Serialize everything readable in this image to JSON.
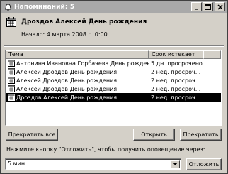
{
  "window": {
    "title": "Напоминаний: 5",
    "minimize_label": "_",
    "maximize_label": "□",
    "close_label": "×"
  },
  "reminder": {
    "subject": "Дроздов Алексей День рождения",
    "start": "Начало: 4 марта 2008 г. 0:00"
  },
  "list": {
    "columns": [
      "Тема",
      "Срок истекает"
    ],
    "rows": [
      {
        "subject": "Антонина Ивановна Горбачева День рождения",
        "due": "5 дн. просрочено"
      },
      {
        "subject": "Алексей Дроздов День рождения",
        "due": "2 нед. просроч..."
      },
      {
        "subject": "Алексей Дроздов День рождения",
        "due": "2 нед. просроч..."
      },
      {
        "subject": "Алексей Дроздов День рождения",
        "due": "2 нед. просроч..."
      },
      {
        "subject": "Дроздов Алексей День рождения",
        "due": "2 нед. просроч..."
      }
    ],
    "selected_index": 4
  },
  "buttons": {
    "dismiss_all": "Прекратить все",
    "open": "Открыть",
    "dismiss": "Прекратить",
    "snooze": "Отложить"
  },
  "snooze": {
    "label": "Нажмите кнопку \"Отложить\", чтобы получить оповещение через:",
    "value": "5 мин."
  },
  "colors": {
    "titlebar": "#a9a9a9",
    "face": "#d4d0c8",
    "selection": "#000000"
  }
}
